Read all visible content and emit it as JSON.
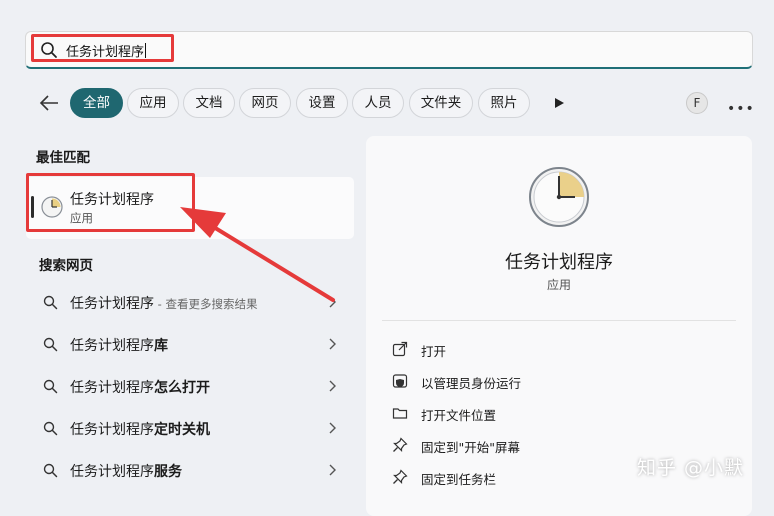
{
  "search": {
    "value": "任务计划程序"
  },
  "filters": {
    "chips": [
      {
        "label": "全部",
        "active": true
      },
      {
        "label": "应用"
      },
      {
        "label": "文档"
      },
      {
        "label": "网页"
      },
      {
        "label": "设置"
      },
      {
        "label": "人员"
      },
      {
        "label": "文件夹"
      },
      {
        "label": "照片"
      }
    ],
    "avatar_letter": "F"
  },
  "best_match": {
    "heading": "最佳匹配",
    "name": "任务计划程序",
    "type": "应用"
  },
  "web": {
    "heading": "搜索网页",
    "results": [
      {
        "prefix": "任务计划程序",
        "suffix": "",
        "sub": " - 查看更多搜索结果"
      },
      {
        "prefix": "任务计划程序",
        "suffix": "库",
        "sub": ""
      },
      {
        "prefix": "任务计划程序",
        "suffix": "怎么打开",
        "sub": ""
      },
      {
        "prefix": "任务计划程序",
        "suffix": "定时关机",
        "sub": ""
      },
      {
        "prefix": "任务计划程序",
        "suffix": "服务",
        "sub": ""
      }
    ]
  },
  "detail": {
    "name": "任务计划程序",
    "type": "应用",
    "actions": [
      {
        "label": "打开",
        "icon": "open-external-icon"
      },
      {
        "label": "以管理员身份运行",
        "icon": "shield-admin-icon"
      },
      {
        "label": "打开文件位置",
        "icon": "folder-icon"
      },
      {
        "label": "固定到\"开始\"屏幕",
        "icon": "pin-icon"
      },
      {
        "label": "固定到任务栏",
        "icon": "pin-icon"
      }
    ]
  },
  "watermark": "知乎 @小默",
  "colors": {
    "accent": "#1f6770",
    "highlight": "#e53a3a"
  }
}
